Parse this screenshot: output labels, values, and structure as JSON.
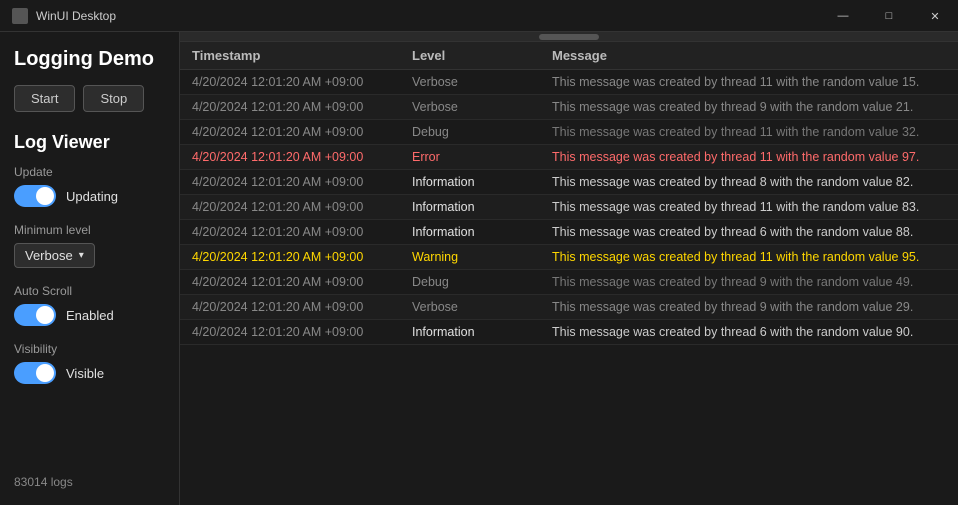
{
  "titlebar": {
    "title": "WinUI Desktop",
    "minimize": "—",
    "maximize": "□",
    "close": "✕"
  },
  "sidebar": {
    "app_title": "Logging Demo",
    "start_label": "Start",
    "stop_label": "Stop",
    "log_viewer_title": "Log Viewer",
    "update_label": "Update",
    "updating_label": "Updating",
    "minimum_level_label": "Minimum level",
    "verbose_label": "Verbose",
    "auto_scroll_label": "Auto Scroll",
    "enabled_label": "Enabled",
    "visibility_label": "Visibility",
    "visible_label": "Visible",
    "footer": "83014  logs"
  },
  "table": {
    "col_timestamp": "Timestamp",
    "col_level": "Level",
    "col_message": "Message",
    "rows": [
      {
        "timestamp": "4/20/2024 12:01:20 AM +09:00",
        "level": "Verbose",
        "message": "This message was created by thread 11 with the random value 15.",
        "type": "verbose"
      },
      {
        "timestamp": "4/20/2024 12:01:20 AM +09:00",
        "level": "Verbose",
        "message": "This message was created by thread 9 with the random value 21.",
        "type": "verbose"
      },
      {
        "timestamp": "4/20/2024 12:01:20 AM +09:00",
        "level": "Debug",
        "message": "This message was created by thread 11 with the random value 32.",
        "type": "debug"
      },
      {
        "timestamp": "4/20/2024 12:01:20 AM +09:00",
        "level": "Error",
        "message": "This message was created by thread 11 with the random value 97.",
        "type": "error"
      },
      {
        "timestamp": "4/20/2024 12:01:20 AM +09:00",
        "level": "Information",
        "message": "This message was created by thread 8 with the random value 82.",
        "type": "information"
      },
      {
        "timestamp": "4/20/2024 12:01:20 AM +09:00",
        "level": "Information",
        "message": "This message was created by thread 11 with the random value 83.",
        "type": "information"
      },
      {
        "timestamp": "4/20/2024 12:01:20 AM +09:00",
        "level": "Information",
        "message": "This message was created by thread 6 with the random value 88.",
        "type": "information"
      },
      {
        "timestamp": "4/20/2024 12:01:20 AM +09:00",
        "level": "Warning",
        "message": "This message was created by thread 11 with the random value 95.",
        "type": "warning"
      },
      {
        "timestamp": "4/20/2024 12:01:20 AM +09:00",
        "level": "Debug",
        "message": "This message was created by thread 9 with the random value 49.",
        "type": "debug"
      },
      {
        "timestamp": "4/20/2024 12:01:20 AM +09:00",
        "level": "Verbose",
        "message": "This message was created by thread 9 with the random value 29.",
        "type": "verbose"
      },
      {
        "timestamp": "4/20/2024 12:01:20 AM +09:00",
        "level": "Information",
        "message": "This message was created by thread 6 with the random value 90.",
        "type": "information"
      }
    ]
  }
}
